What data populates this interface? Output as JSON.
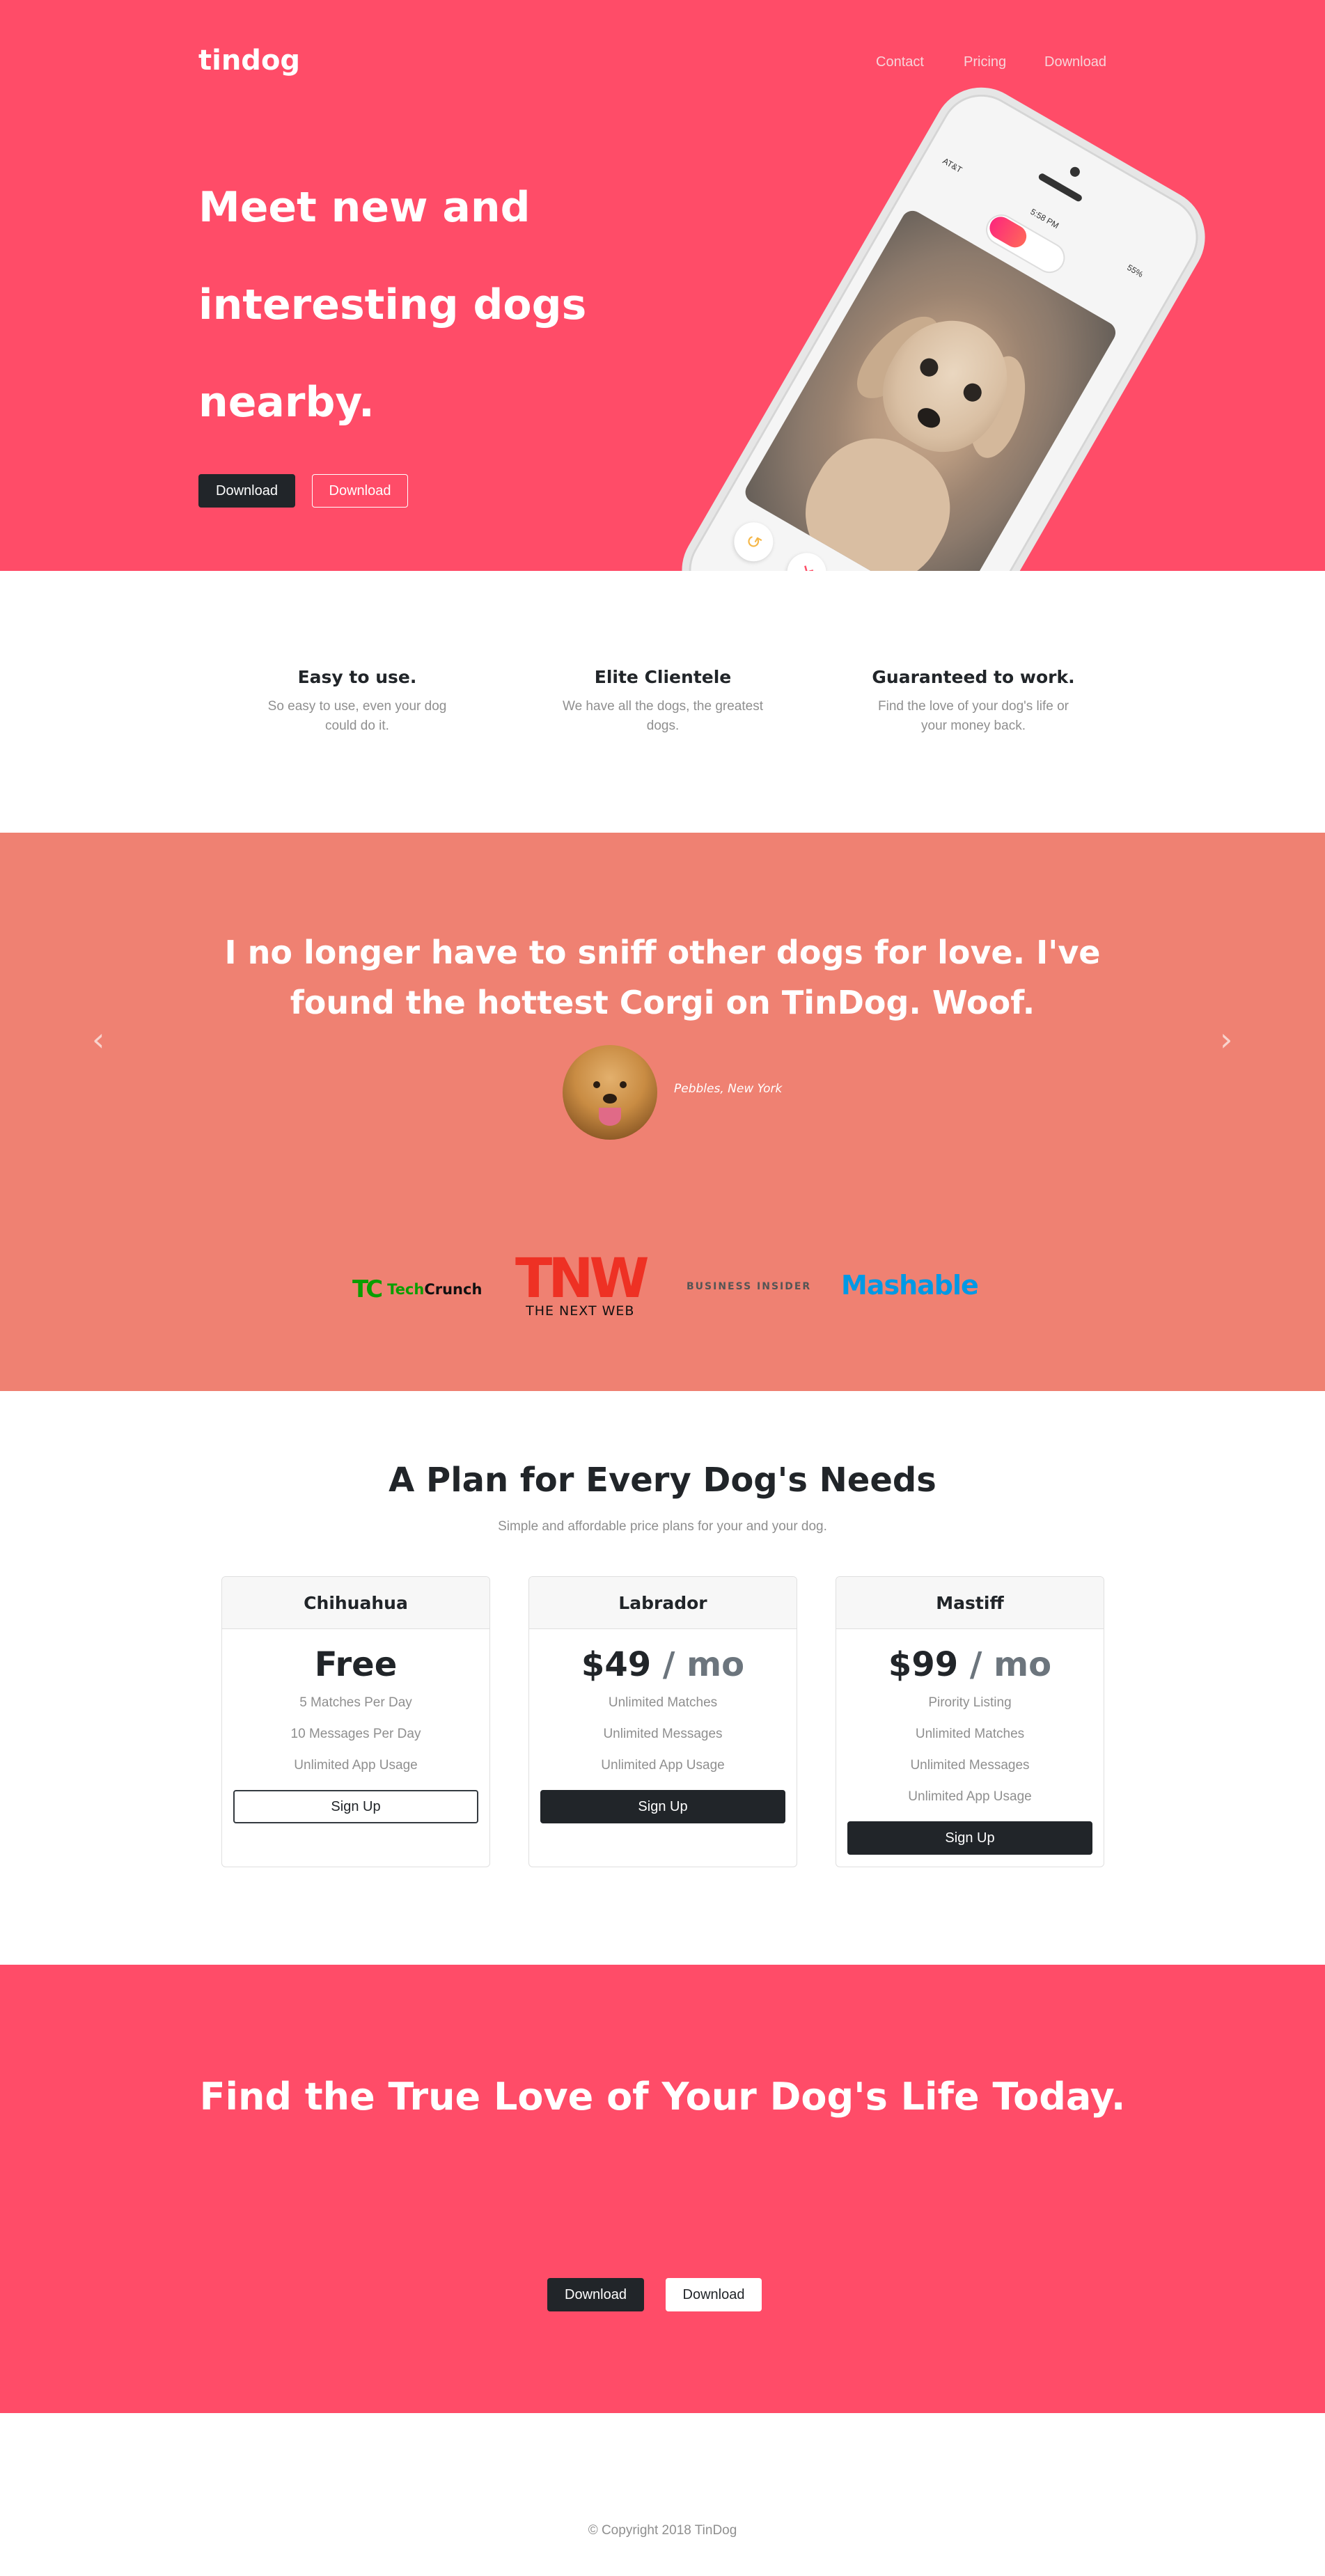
{
  "nav": {
    "brand": "tindog",
    "links": [
      "Contact",
      "Pricing",
      "Download"
    ]
  },
  "hero": {
    "title": "Meet new and interesting dogs nearby.",
    "buttons": [
      "Download",
      "Download"
    ],
    "phone": {
      "carrier": "AT&T",
      "time": "5:58 PM",
      "battery": "55%"
    }
  },
  "features": [
    {
      "title": "Easy to use.",
      "text": "So easy to use, even your dog could do it."
    },
    {
      "title": "Elite Clientele",
      "text": "We have all the dogs, the greatest dogs."
    },
    {
      "title": "Guaranteed to work.",
      "text": "Find the love of your dog's life or your money back."
    }
  ],
  "testimonial": {
    "quote": "I no longer have to sniff other dogs for love. I've found the hottest Corgi on TinDog. Woof.",
    "author": "Pebbles, New York",
    "prev_icon": "chevron-left-icon",
    "next_icon": "chevron-right-icon"
  },
  "press": {
    "techcrunch_mark": "TC",
    "techcrunch_tech": "Tech",
    "techcrunch_crunch": "Crunch",
    "tnw_mark": "TNW",
    "tnw_name": "THE NEXT WEB",
    "business_insider": "BUSINESS INSIDER",
    "mashable": "Mashable"
  },
  "pricing": {
    "title": "A Plan for Every Dog's Needs",
    "subtitle": "Simple and affordable price plans for your and your dog.",
    "plans": [
      {
        "name": "Chihuahua",
        "price": "Free",
        "per": "",
        "features": [
          "5 Matches Per Day",
          "10 Messages Per Day",
          "Unlimited App Usage"
        ],
        "button": "Sign Up"
      },
      {
        "name": "Labrador",
        "price": "$49",
        "per": " / mo",
        "features": [
          "Unlimited Matches",
          "Unlimited Messages",
          "Unlimited App Usage"
        ],
        "button": "Sign Up"
      },
      {
        "name": "Mastiff",
        "price": "$99",
        "per": " / mo",
        "features": [
          "Pirority Listing",
          "Unlimited Matches",
          "Unlimited Messages",
          "Unlimited App Usage"
        ],
        "button": "Sign Up"
      }
    ]
  },
  "cta": {
    "title": "Find the True Love of Your Dog's Life Today.",
    "buttons": [
      "Download",
      "Download"
    ]
  },
  "footer": {
    "copyright": "© Copyright 2018 TinDog"
  },
  "colors": {
    "brand_red": "#ff4c68",
    "testimonial_bg": "#ef8172",
    "dark": "#212529"
  }
}
